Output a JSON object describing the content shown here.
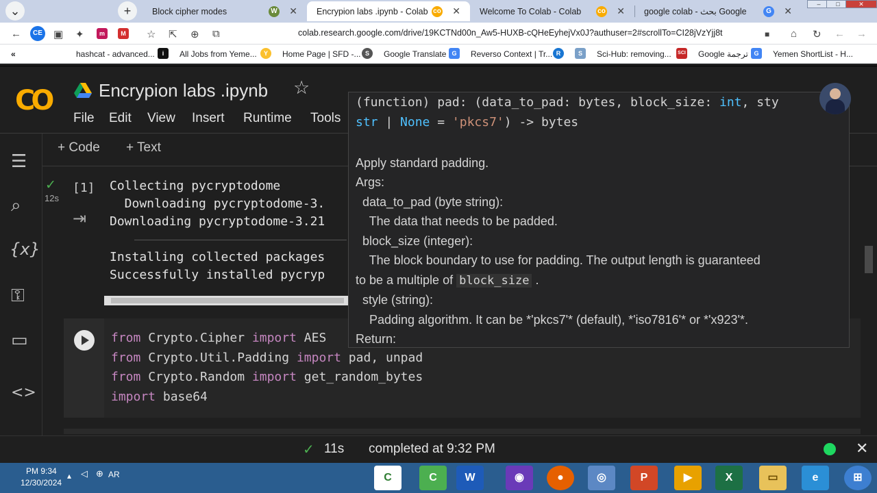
{
  "tabs": [
    {
      "label": "Block cipher modes"
    },
    {
      "label": "Encrypion labs .ipynb - Colab"
    },
    {
      "label": "Welcome To Colab - Colab"
    },
    {
      "label": "google colab - بحث Google"
    }
  ],
  "address": {
    "url": "colab.research.google.com/drive/19KCTNd00n_Aw5-HUXB-cQHeEyhejVx0J?authuser=2#scrollTo=CI28jVzYjj8t"
  },
  "bookmarks": [
    {
      "label": "hashcat - advanced..."
    },
    {
      "label": "All Jobs from Yeme..."
    },
    {
      "label": "Home Page | SFD -..."
    },
    {
      "label": "Google Translate"
    },
    {
      "label": "Reverso Context | Tr..."
    },
    {
      "label": "Sci-Hub: removing..."
    },
    {
      "label": "Google ترجمة"
    },
    {
      "label": "Yemen ShortList - H..."
    }
  ],
  "notebook": {
    "title": "Encrypion labs .ipynb",
    "menu": [
      "File",
      "Edit",
      "View",
      "Insert",
      "Runtime",
      "Tools"
    ],
    "add_code": "+ Code",
    "add_text": "+ Text"
  },
  "cell1": {
    "exec_count": "[1]",
    "duration": "12s",
    "output": [
      "Collecting pycryptodome",
      "  Downloading pycryptodome-3.",
      "Downloading pycryptodome-3.21",
      "Installing collected packages",
      "Successfully installed pycryp"
    ]
  },
  "cell2": {
    "lines": [
      {
        "kw": "from",
        "rest": " Crypto.Cipher ",
        "kw2": "import",
        "rest2": " AES"
      },
      {
        "kw": "from",
        "rest": " Crypto.Util.Padding ",
        "kw2": "import",
        "rest2": " pad, unpad"
      },
      {
        "kw": "from",
        "rest": " Crypto.Random ",
        "kw2": "import",
        "rest2": " get_random_bytes"
      },
      {
        "kw": "import",
        "rest": " base64",
        "kw2": "",
        "rest2": ""
      }
    ]
  },
  "tooltip": {
    "sig1a": "(function) pad: (data_to_pad: bytes, block_size: ",
    "sig1b": "int",
    "sig1c": ", sty",
    "sig2a": "str",
    "sig2b": " | ",
    "sig2c": "None",
    "sig2d": " = ",
    "sig2e": "'pkcs7'",
    "sig2f": ") -> bytes",
    "doc": {
      "l1": "Apply standard padding.",
      "l2": "Args:",
      "l3": "  data_to_pad (byte string):",
      "l4": "    The data that needs to be padded.",
      "l5": "  block_size (integer):",
      "l6": "    The block boundary to use for padding. The output length is guaranteed",
      "l7a": "to be a multiple of ",
      "l7code": "block_size",
      "l7b": " .",
      "l8": "  style (string):",
      "l9": "    Padding algorithm. It can be *'pkcs7'* (default), *'iso7816'* or *'x923'*.",
      "l10": "Return:"
    }
  },
  "status": {
    "check": "✓",
    "duration": "11s",
    "text": "completed at 9:32 PM"
  },
  "taskbar": {
    "time": "PM 9:34",
    "date": "12/30/2024",
    "lang": "AR"
  }
}
